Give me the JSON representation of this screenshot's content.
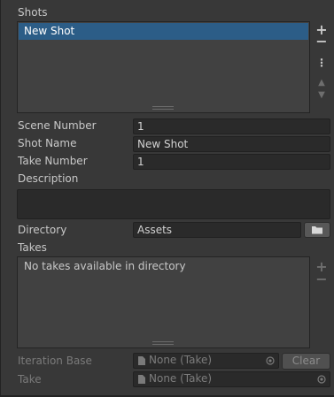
{
  "shots": {
    "label": "Shots",
    "items": [
      "New Shot"
    ],
    "buttons": {
      "add": "+",
      "remove": "−",
      "menu": "⋮",
      "up": "▲",
      "down": "▼"
    }
  },
  "fields": {
    "scene_number": {
      "label": "Scene Number",
      "value": "1"
    },
    "shot_name": {
      "label": "Shot Name",
      "value": "New Shot"
    },
    "take_number": {
      "label": "Take Number",
      "value": "1"
    },
    "description": {
      "label": "Description",
      "value": ""
    },
    "directory": {
      "label": "Directory",
      "value": "Assets"
    }
  },
  "takes": {
    "label": "Takes",
    "empty_message": "No takes available in directory",
    "buttons": {
      "add": "+",
      "remove": "−"
    }
  },
  "iteration_base": {
    "label": "Iteration Base",
    "value": "None (Take)",
    "clear_label": "Clear"
  },
  "take": {
    "label": "Take",
    "value": "None (Take)"
  },
  "icons": {
    "folder": "folder-icon",
    "document": "document-icon",
    "object_picker": "object-picker-icon"
  },
  "colors": {
    "background": "#383838",
    "selection": "#2c5d87",
    "field": "#2a2a2a"
  }
}
